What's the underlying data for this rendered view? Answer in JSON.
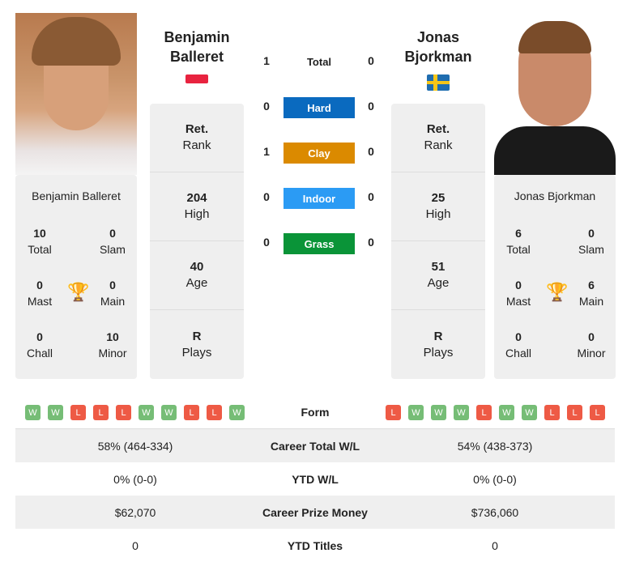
{
  "p1": {
    "name_line1": "Benjamin",
    "name_line2": "Balleret",
    "full_name": "Benjamin Balleret",
    "flag": "red-white-flag",
    "rank": "Ret.",
    "rank_label": "Rank",
    "high": "204",
    "high_label": "High",
    "age": "40",
    "age_label": "Age",
    "plays": "R",
    "plays_label": "Plays",
    "total": "10",
    "total_label": "Total",
    "slam": "0",
    "slam_label": "Slam",
    "mast": "0",
    "mast_label": "Mast",
    "main": "0",
    "main_label": "Main",
    "chall": "0",
    "chall_label": "Chall",
    "minor": "10",
    "minor_label": "Minor",
    "form": [
      "W",
      "W",
      "L",
      "L",
      "L",
      "W",
      "W",
      "L",
      "L",
      "W"
    ]
  },
  "p2": {
    "name_line1": "Jonas",
    "name_line2": "Bjorkman",
    "full_name": "Jonas Bjorkman",
    "flag": "sweden-flag",
    "rank": "Ret.",
    "rank_label": "Rank",
    "high": "25",
    "high_label": "High",
    "age": "51",
    "age_label": "Age",
    "plays": "R",
    "plays_label": "Plays",
    "total": "6",
    "total_label": "Total",
    "slam": "0",
    "slam_label": "Slam",
    "mast": "0",
    "mast_label": "Mast",
    "main": "6",
    "main_label": "Main",
    "chall": "0",
    "chall_label": "Chall",
    "minor": "0",
    "minor_label": "Minor",
    "form": [
      "L",
      "W",
      "W",
      "W",
      "L",
      "W",
      "W",
      "L",
      "L",
      "L"
    ]
  },
  "h2h": [
    {
      "label": "Total",
      "p1": "1",
      "p2": "0",
      "color": ""
    },
    {
      "label": "Hard",
      "p1": "0",
      "p2": "0",
      "color": "#0a6abf"
    },
    {
      "label": "Clay",
      "p1": "1",
      "p2": "0",
      "color": "#db8a00"
    },
    {
      "label": "Indoor",
      "p1": "0",
      "p2": "0",
      "color": "#2b9bf4"
    },
    {
      "label": "Grass",
      "p1": "0",
      "p2": "0",
      "color": "#0a9438"
    }
  ],
  "compare": [
    {
      "label": "Form"
    },
    {
      "label": "Career Total W/L",
      "p1": "58% (464-334)",
      "p2": "54% (438-373)"
    },
    {
      "label": "YTD W/L",
      "p1": "0% (0-0)",
      "p2": "0% (0-0)"
    },
    {
      "label": "Career Prize Money",
      "p1": "$62,070",
      "p2": "$736,060"
    },
    {
      "label": "YTD Titles",
      "p1": "0",
      "p2": "0"
    }
  ]
}
